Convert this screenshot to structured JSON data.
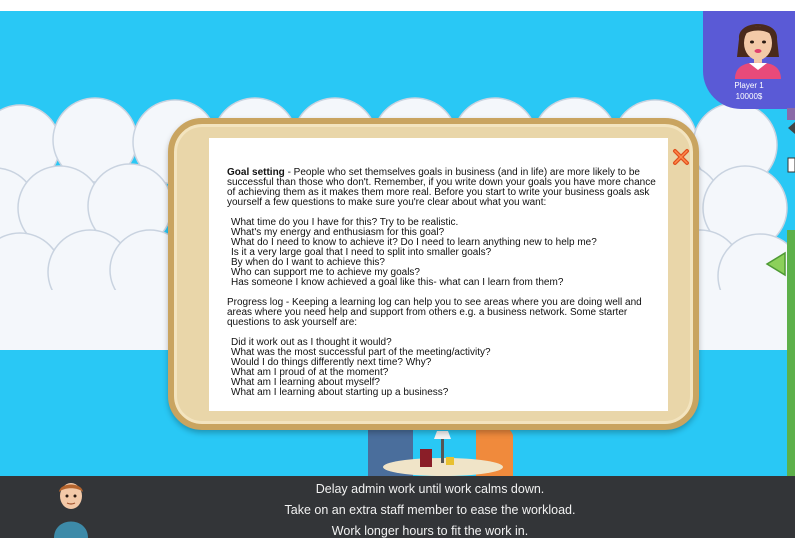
{
  "player": {
    "name": "Player 1",
    "money": "10000$"
  },
  "dialog": {
    "goal_heading": "Goal setting",
    "goal_intro": " - People who set themselves goals in business (and in life) are more likely to be successful than those who don't. Remember, if you write down your goals you have more chance of achieving them as it makes them more real. Before you start to write your business goals ask yourself a few questions to make sure you're clear about what you want:",
    "goal_questions": [
      "What time do you I have for this? Try to be realistic.",
      "What's my energy and enthusiasm for this goal?",
      "What do I need to know to achieve it? Do I need to learn anything new to help me?",
      "Is it a very large goal that I need to split into smaller goals?",
      "By when do I want to achieve this?",
      "Who can support me to achieve my goals?",
      "Has someone I know achieved a goal like this- what can I learn from them?"
    ],
    "progress_intro": "Progress log - Keeping a learning log can help you to see areas where you are doing well and areas where you need help and support from others e.g. a business network. Some starter questions to ask yourself are:",
    "progress_questions": [
      "Did it work out as I thought it would?",
      "What was the most successful part of the meeting/activity?",
      "Would I do things differently next time? Why?",
      "What am I proud of at the moment?",
      "What am I learning about myself?",
      "What am I learning about starting up a business?"
    ]
  },
  "choices": [
    "Delay admin work until work calms down.",
    "Take on an extra staff member to ease the workload.",
    "Work longer hours to fit the work in."
  ],
  "colors": {
    "sky": "#29c8f5",
    "player_panel": "#5a5ad6",
    "bottom_bar": "#333538",
    "dialog_frame": "#c9a460",
    "close": "#e0501e"
  }
}
